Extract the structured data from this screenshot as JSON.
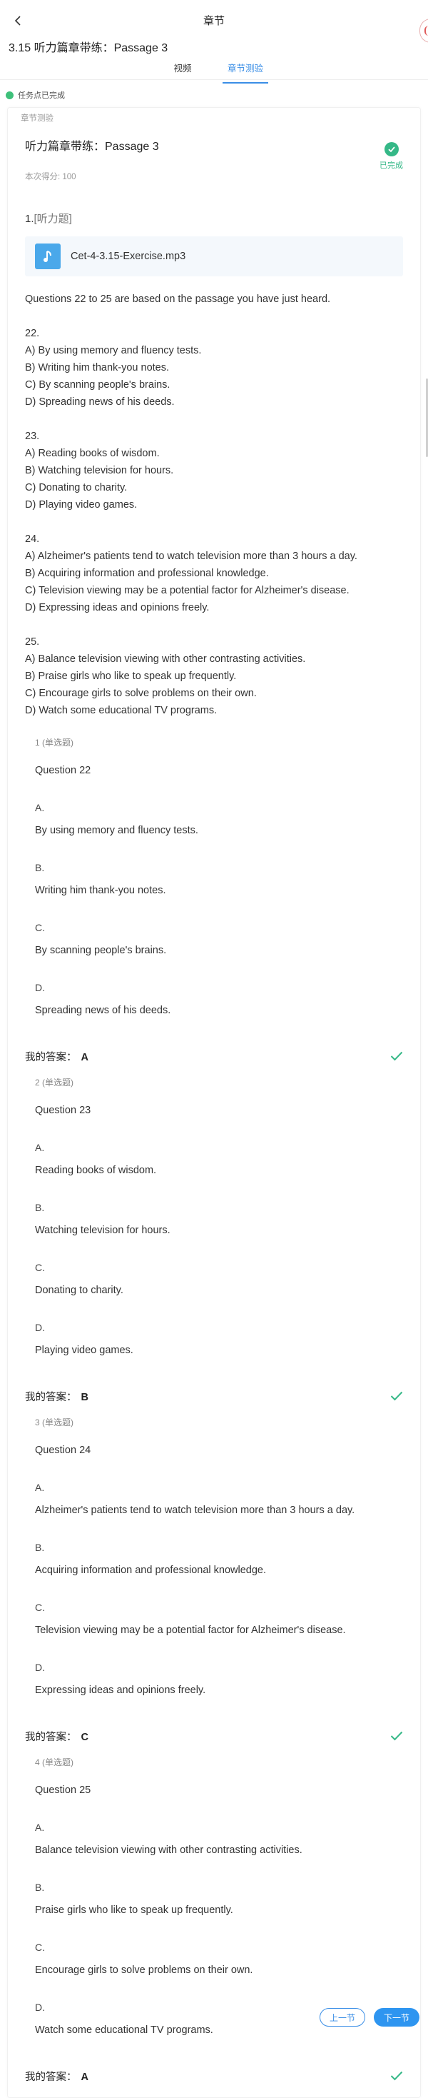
{
  "nav": {
    "title": "章节"
  },
  "chapter": {
    "title": "3.15 听力篇章带练：Passage 3"
  },
  "tabs": [
    {
      "label": "视频"
    },
    {
      "label": "章节测验"
    }
  ],
  "task": {
    "status": "任务点已完成"
  },
  "quiz": {
    "section_label": "章节测验",
    "title": "听力篇章带练：Passage 3",
    "score": "本次得分: 100",
    "status": "已完成",
    "question_number": "1.",
    "question_tag": "[听力题]",
    "audio_file": "Cet-4-3.15-Exercise.mp3",
    "passage": [
      [
        "Questions 22 to 25 are based on the passage you have just heard."
      ],
      [
        "22.",
        "A) By using memory and fluency tests.",
        "B) Writing him thank-you notes.",
        "C) By scanning people's brains.",
        "D) Spreading news of his deeds."
      ],
      [
        "23.",
        "A) Reading books of wisdom.",
        "B) Watching television for hours.",
        "C) Donating to charity.",
        "D) Playing video games."
      ],
      [
        "24.",
        "A) Alzheimer's patients tend to watch television more than 3 hours a day.",
        "B) Acquiring information and professional knowledge.",
        "C) Television viewing may be a potential factor for Alzheimer's disease.",
        "D) Expressing ideas and opinions freely."
      ],
      [
        "25.",
        "A) Balance television viewing with other contrasting activities.",
        "B) Praise girls who like to speak up frequently.",
        "C) Encourage girls to solve problems on their own.",
        "D) Watch some educational TV programs."
      ]
    ],
    "answer_label": "我的答案：",
    "sub_questions": [
      {
        "type": "1 (单选题)",
        "title": "Question 22",
        "options": [
          {
            "letter": "A.",
            "text": "By using memory and fluency tests."
          },
          {
            "letter": "B.",
            "text": "Writing him thank-you notes."
          },
          {
            "letter": "C.",
            "text": "By scanning people's brains."
          },
          {
            "letter": "D.",
            "text": "Spreading news of his deeds."
          }
        ],
        "answer": "A"
      },
      {
        "type": "2 (单选题)",
        "title": "Question 23",
        "options": [
          {
            "letter": "A.",
            "text": "Reading books of wisdom."
          },
          {
            "letter": "B.",
            "text": "Watching television for hours."
          },
          {
            "letter": "C.",
            "text": "Donating to charity."
          },
          {
            "letter": "D.",
            "text": "Playing video games."
          }
        ],
        "answer": "B"
      },
      {
        "type": "3 (单选题)",
        "title": "Question 24",
        "options": [
          {
            "letter": "A.",
            "text": "Alzheimer's patients tend to watch television more than 3 hours a day."
          },
          {
            "letter": "B.",
            "text": "Acquiring information and professional knowledge."
          },
          {
            "letter": "C.",
            "text": "Television viewing may be a potential factor for Alzheimer's disease."
          },
          {
            "letter": "D.",
            "text": "Expressing ideas and opinions freely."
          }
        ],
        "answer": "C"
      },
      {
        "type": "4 (单选题)",
        "title": "Question 25",
        "options": [
          {
            "letter": "A.",
            "text": "Balance television viewing with other contrasting activities."
          },
          {
            "letter": "B.",
            "text": "Praise girls who like to speak up frequently."
          },
          {
            "letter": "C.",
            "text": "Encourage girls to solve problems on their own."
          },
          {
            "letter": "D.",
            "text": "Watch some educational TV programs."
          }
        ],
        "answer": "A"
      }
    ]
  },
  "footer": {
    "prev_label": "上一节",
    "next_label": "下一节"
  },
  "colors": {
    "accent": "#3a8ee6",
    "success": "#35b887",
    "audio": "#4aa8ea"
  },
  "icons": {
    "back": "chevron-left-icon",
    "done": "check-circle-icon",
    "audio": "music-note-icon",
    "correct": "checkmark-icon"
  }
}
